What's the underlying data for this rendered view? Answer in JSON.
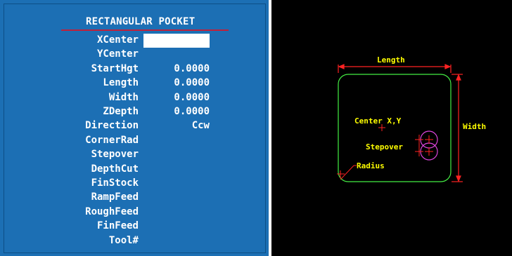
{
  "form": {
    "title": "RECTANGULAR POCKET",
    "fields": [
      {
        "label": "XCenter",
        "value": ""
      },
      {
        "label": "YCenter",
        "value": ""
      },
      {
        "label": "StartHgt",
        "value": "0.0000"
      },
      {
        "label": "Length",
        "value": "0.0000"
      },
      {
        "label": "Width",
        "value": "0.0000"
      },
      {
        "label": "ZDepth",
        "value": "0.0000"
      },
      {
        "label": "Direction",
        "value": "Ccw"
      },
      {
        "label": "CornerRad",
        "value": ""
      },
      {
        "label": "Stepover",
        "value": ""
      },
      {
        "label": "DepthCut",
        "value": ""
      },
      {
        "label": "FinStock",
        "value": ""
      },
      {
        "label": "RampFeed",
        "value": ""
      },
      {
        "label": "RoughFeed",
        "value": ""
      },
      {
        "label": "FinFeed",
        "value": ""
      },
      {
        "label": "Tool#",
        "value": ""
      }
    ]
  },
  "diagram": {
    "length_label": "Length",
    "width_label": "Width",
    "center_label": "Center X,Y",
    "stepover_label": "Stepover",
    "radius_label": "Radius"
  },
  "colors": {
    "form_bg": "#1c6fb4",
    "diagram_bg": "#000000",
    "pocket_outline": "#44ee44",
    "dimension": "#ff2222",
    "tool_circle": "#dd44dd",
    "label": "#ffff00"
  }
}
